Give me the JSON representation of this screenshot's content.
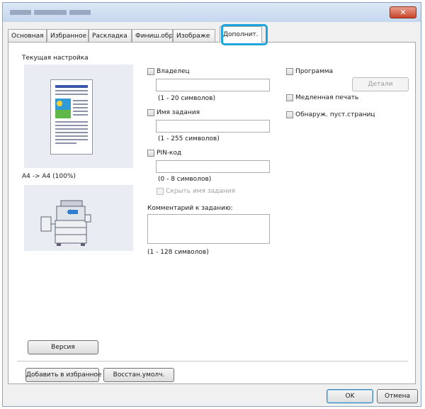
{
  "window": {
    "close_label": "✕"
  },
  "tabs": [
    "Основная",
    "Избранное",
    "Раскладка",
    "Финиш.обр.",
    "Изображе",
    "Дополнит."
  ],
  "left": {
    "current_setting_label": "Текущая настройка",
    "size_text": "A4 -> A4 (100%)",
    "version_button": "Версия"
  },
  "owner": {
    "label": "Владелец",
    "value": "",
    "hint": "(1 - 20 символов)"
  },
  "job_name": {
    "label": "Имя задания",
    "value": "",
    "hint": "(1 - 255 символов)"
  },
  "pin": {
    "label": "PIN-код",
    "value": "",
    "hint": "(0 - 8 символов)",
    "hide_job_label": "Скрыть имя задания"
  },
  "comment": {
    "label": "Комментарий к заданию:",
    "value": "",
    "hint": "(1 - 128 символов)"
  },
  "right": {
    "program_label": "Программа",
    "details_button": "Детали",
    "slow_print_label": "Медленная печать",
    "blank_page_label": "Обнаруж. пуст.страниц"
  },
  "bottom": {
    "add_favorite_button": "Добавить в избранное",
    "restore_defaults_button": "Восстан.умолч.",
    "ok_button": "OK",
    "cancel_button": "Отмена"
  },
  "colors": {
    "highlight": "#1fa4dc",
    "page_stripe": "#3b58a6",
    "close": "#c9442a"
  }
}
